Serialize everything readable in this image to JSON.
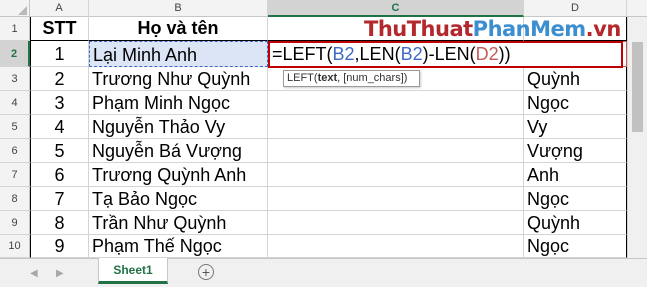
{
  "columns": [
    "A",
    "B",
    "C",
    "D"
  ],
  "rows": [
    "1",
    "2",
    "3",
    "4",
    "5",
    "6",
    "7",
    "8",
    "9",
    "10"
  ],
  "header": {
    "stt": "STT",
    "name": "Họ và tên"
  },
  "data": [
    {
      "stt": "1",
      "name": "Lại Minh Anh",
      "d": ""
    },
    {
      "stt": "2",
      "name": "Trương Như Quỳnh",
      "d": "Quỳnh"
    },
    {
      "stt": "3",
      "name": "Phạm Minh Ngọc",
      "d": "Ngọc"
    },
    {
      "stt": "4",
      "name": "Nguyễn Thảo Vy",
      "d": "Vy"
    },
    {
      "stt": "5",
      "name": "Nguyễn Bá Vượng",
      "d": "Vượng"
    },
    {
      "stt": "6",
      "name": "Trương Quỳnh Anh",
      "d": "Anh"
    },
    {
      "stt": "7",
      "name": "Tạ Bảo Ngọc",
      "d": "Ngọc"
    },
    {
      "stt": "8",
      "name": "Trần Như Quỳnh",
      "d": "Quỳnh"
    },
    {
      "stt": "9",
      "name": "Phạm Thế Ngọc",
      "d": "Ngọc"
    }
  ],
  "formula": {
    "p1": "=LEFT(",
    "r1": "B2",
    "p2": ",LEN(",
    "r2": "B2",
    "p3": ")-LEN(",
    "r3": "D2",
    "p4": "))"
  },
  "tooltip": {
    "fn": "LEFT(",
    "arg1": "text",
    "rest": ", [num_chars])"
  },
  "watermark": {
    "part1": "ThuThuat",
    "part2": "PhanMem",
    "part3": ".vn"
  },
  "sheet_tab": "Sheet1",
  "add_sheet": "+",
  "colors": {
    "accent": "#217346",
    "formula_border": "#c00000",
    "ref_b": "#3e6ac1",
    "ref_d": "#c55a5a"
  }
}
